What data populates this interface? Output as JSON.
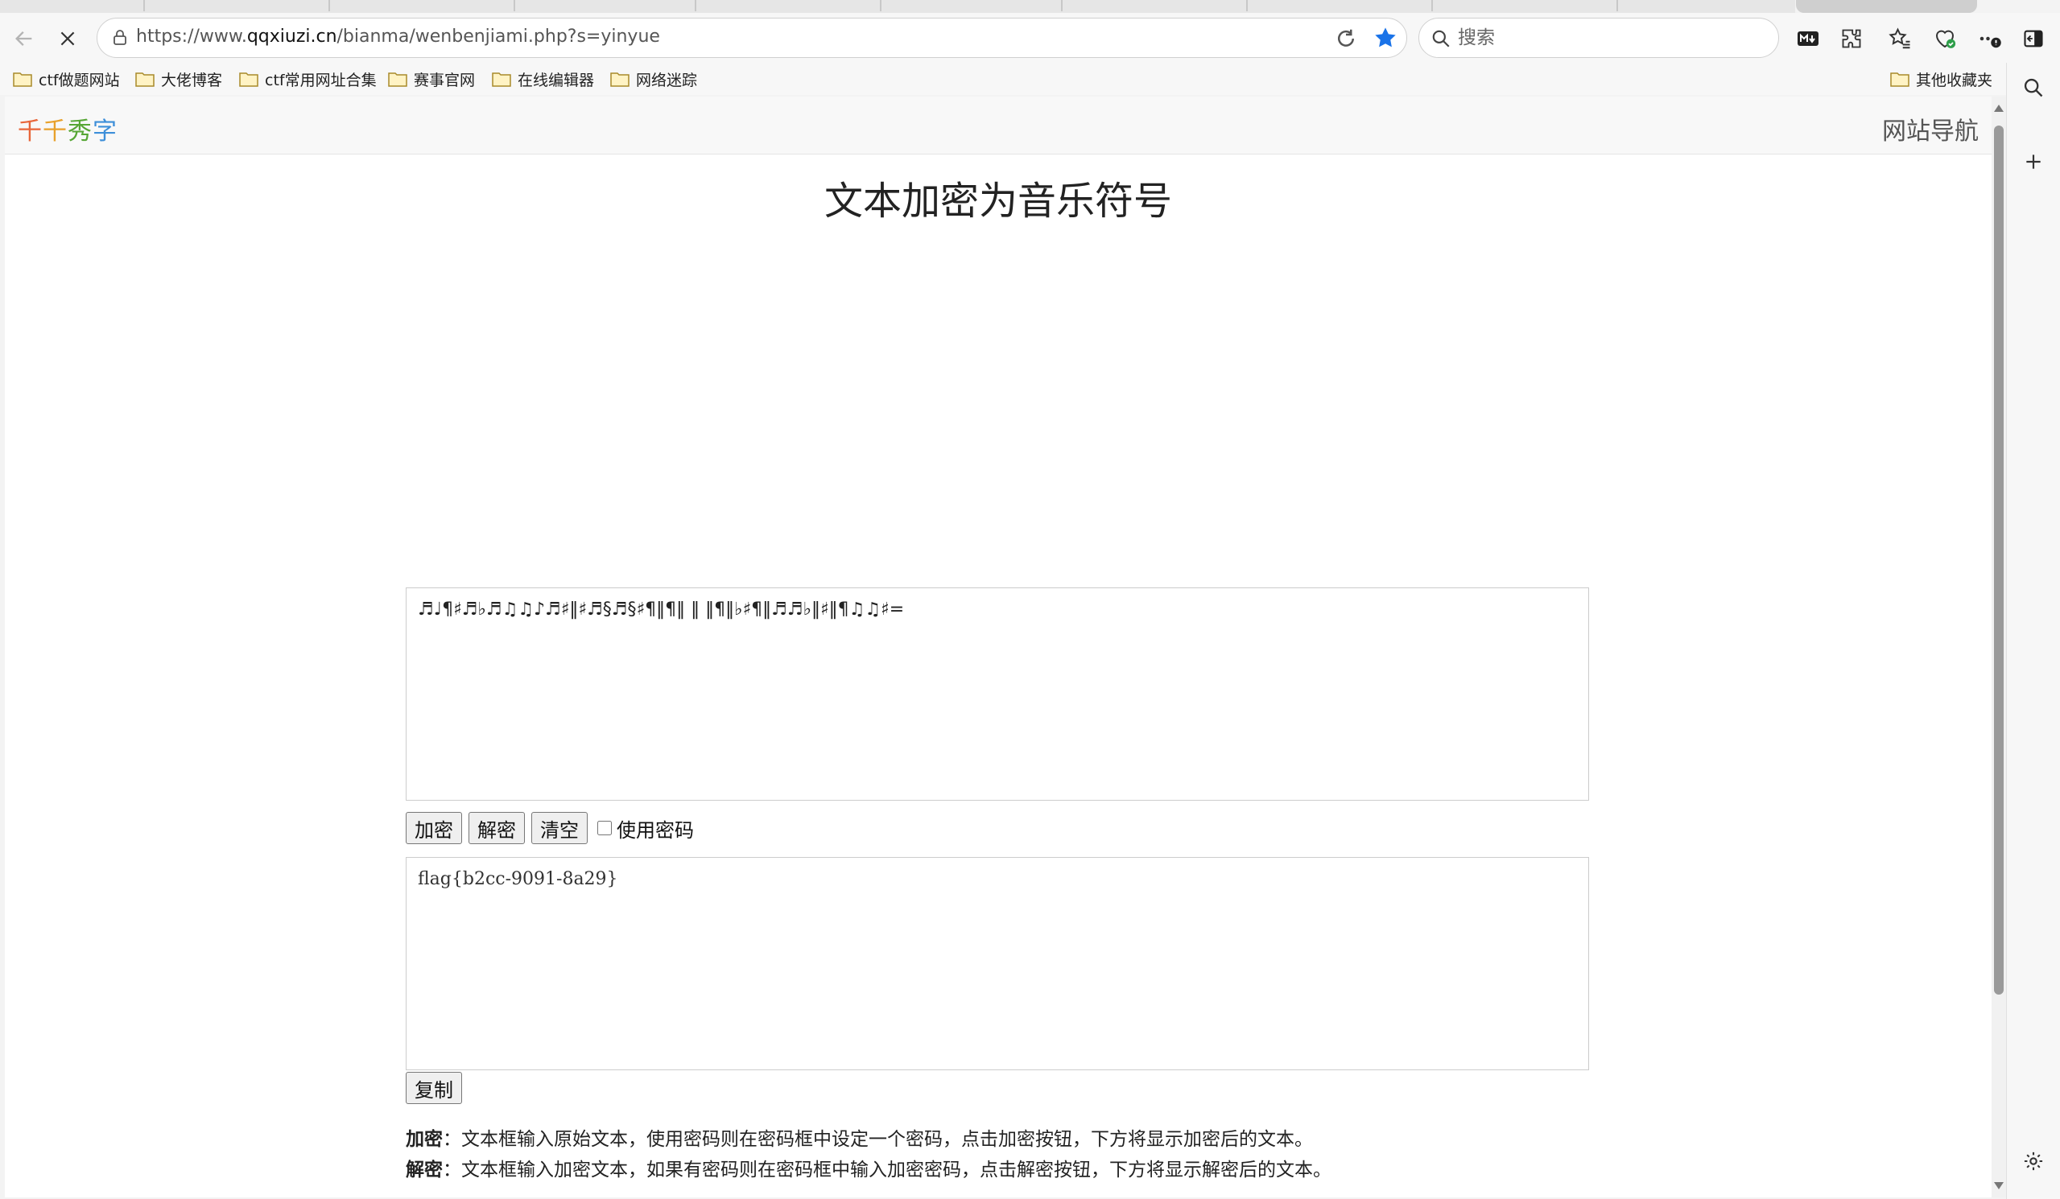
{
  "browser": {
    "url_prefix": "https://www.",
    "url_host": "qqxiuzi.cn",
    "url_path": "/bianma/wenbenjiami.php?s=yinyue",
    "search_placeholder": "搜索",
    "accent_color": "#1a73e8"
  },
  "bookmarks": [
    {
      "label": "ctf做题网站"
    },
    {
      "label": "大佬博客"
    },
    {
      "label": "ctf常用网址合集"
    },
    {
      "label": "赛事官网"
    },
    {
      "label": "在线编辑器"
    },
    {
      "label": "网络迷踪"
    }
  ],
  "other_bookmarks": "其他收藏夹",
  "site": {
    "logo": [
      "千",
      "千",
      "秀",
      "字"
    ],
    "nav": "网站导航",
    "title": "文本加密为音乐符号"
  },
  "form": {
    "input_text": "♬♩¶♯♬♭♬♫♫♪♬♯‖♯♬§♬§♯¶‖¶‖ ‖ ‖¶‖♭♯¶‖♬♬♭‖♯‖¶♫♫♯=",
    "encrypt_label": "加密",
    "decrypt_label": "解密",
    "clear_label": "清空",
    "use_password_label": "使用密码",
    "output_text": "flag{b2cc-9091-8a29}",
    "copy_label": "复制"
  },
  "help": {
    "encrypt_term": "加密",
    "encrypt_desc": "：文本框输入原始文本，使用密码则在密码框中设定一个密码，点击加密按钮，下方将显示加密后的文本。",
    "decrypt_term": "解密",
    "decrypt_desc": "：文本框输入加密文本，如果有密码则在密码框中输入加密密码，点击解密按钮，下方将显示解密后的文本。"
  }
}
